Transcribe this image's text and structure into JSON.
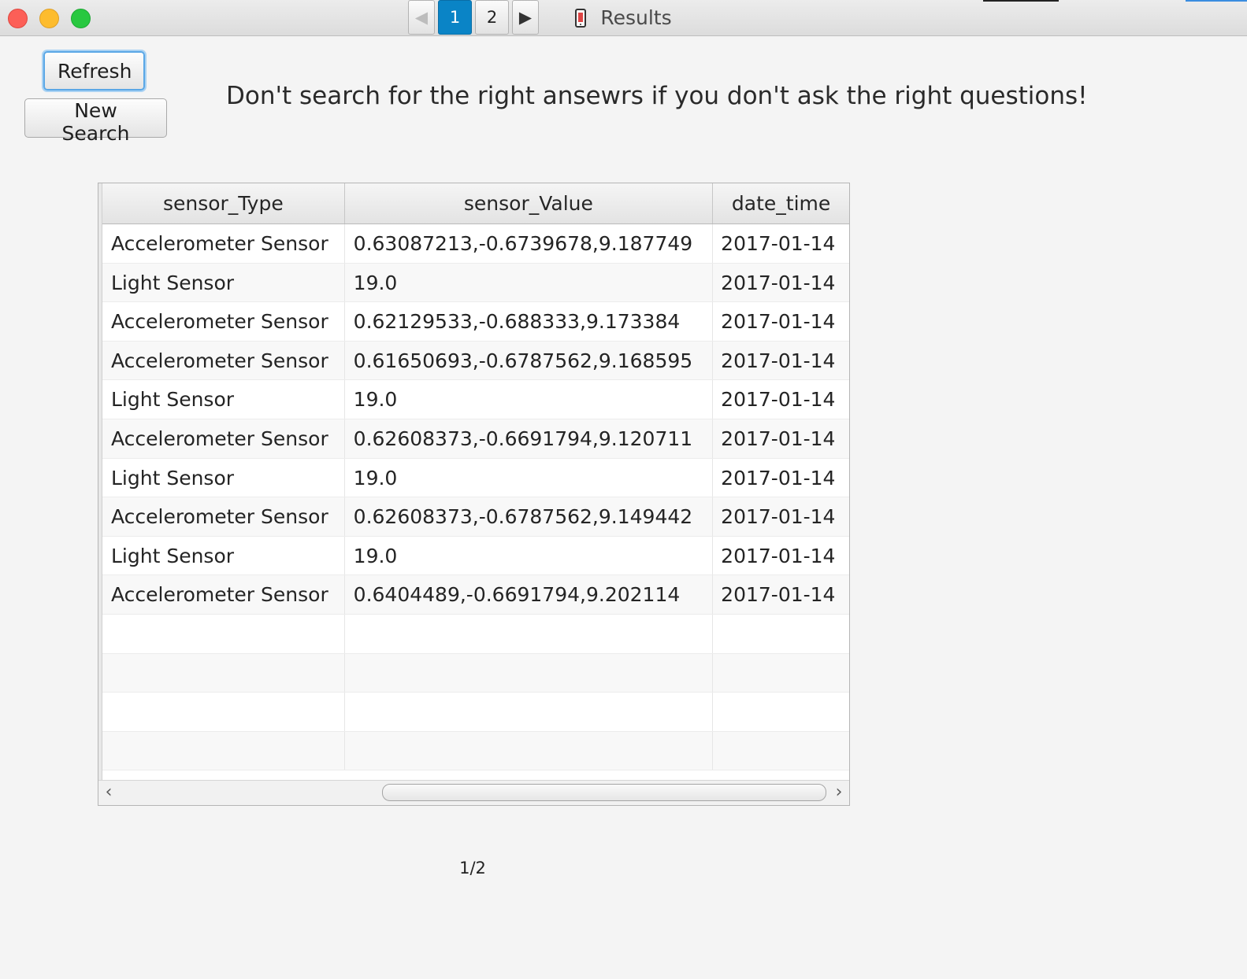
{
  "window": {
    "title": "Results",
    "icon": "phone-icon"
  },
  "toolbar": {
    "refresh_label": "Refresh",
    "new_search_label": "New Search"
  },
  "quote": "Don't search for the right ansewrs if you don't ask the right questions!",
  "table": {
    "columns": [
      "sensor_Type",
      "sensor_Value",
      "date_time"
    ],
    "rows": [
      [
        "Accelerometer Sensor",
        "0.63087213,-0.6739678,9.187749",
        "2017-01-14"
      ],
      [
        "Light Sensor",
        "19.0",
        "2017-01-14"
      ],
      [
        "Accelerometer Sensor",
        "0.62129533,-0.688333,9.173384",
        "2017-01-14"
      ],
      [
        "Accelerometer Sensor",
        "0.61650693,-0.6787562,9.168595",
        "2017-01-14"
      ],
      [
        "Light Sensor",
        "19.0",
        "2017-01-14"
      ],
      [
        "Accelerometer Sensor",
        "0.62608373,-0.6691794,9.120711",
        "2017-01-14"
      ],
      [
        "Light Sensor",
        "19.0",
        "2017-01-14"
      ],
      [
        "Accelerometer Sensor",
        "0.62608373,-0.6787562,9.149442",
        "2017-01-14"
      ],
      [
        "Light Sensor",
        "19.0",
        "2017-01-14"
      ],
      [
        "Accelerometer Sensor",
        "0.6404489,-0.6691794,9.202114",
        "2017-01-14"
      ],
      [
        "",
        "",
        ""
      ],
      [
        "",
        "",
        ""
      ],
      [
        "",
        "",
        ""
      ],
      [
        "",
        "",
        ""
      ]
    ]
  },
  "pagination": {
    "pages": [
      "1",
      "2"
    ],
    "current": "1",
    "status": "1/2",
    "prev_icon": "triangle-left-icon",
    "next_icon": "triangle-right-icon"
  },
  "colors": {
    "accent": "#0a84c6",
    "focus_ring": "#5aa7e6"
  }
}
